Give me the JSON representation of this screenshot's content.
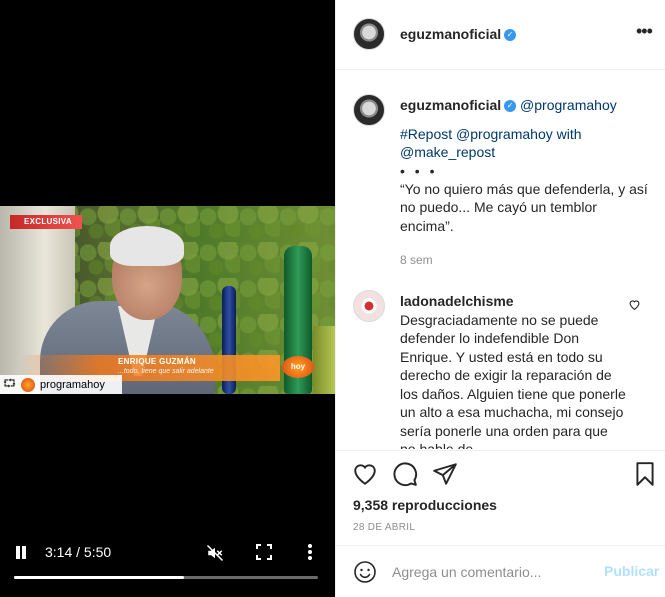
{
  "video": {
    "exclusive_label": "EXCLUSIVA",
    "lower_third_name": "ENRIQUE GUZMÁN",
    "lower_third_sub": "...todo, tiene que salir adelante",
    "channel_logo_text": "hoy",
    "watermark_user": "programahoy",
    "time": "3:14 / 5:50",
    "progress": 0.56
  },
  "header": {
    "username": "eguzmanoficial",
    "more_label": "•••"
  },
  "caption": {
    "username": "eguzmanoficial",
    "mention": "@programahoy",
    "repost_line1": "#Repost @programahoy with",
    "repost_line2": "@make_repost",
    "dots": "• • •",
    "quote": "“Yo no quiero más que defenderla, y así no puedo... Me cayó un temblor encima”.",
    "time_ago": "8 sem"
  },
  "comment": {
    "username": "ladonadelchisme",
    "text": "Desgraciadamente no se puede defender lo indefendible Don Enrique. Y usted está en todo su derecho de exigir la reparación de los daños. Alguien tiene que ponerle un alto a esa muchacha, mi consejo sería ponerle una orden para que no hable de"
  },
  "actions": {
    "views": "9,358 reproducciones",
    "date": "28 DE ABRIL"
  },
  "add_comment": {
    "placeholder": "Agrega un comentario...",
    "post_label": "Publicar"
  }
}
